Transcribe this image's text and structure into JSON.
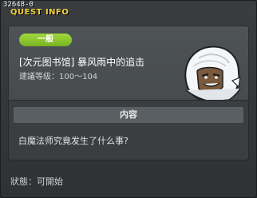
{
  "window": {
    "id": "32648-0",
    "title": "QUEST INFO"
  },
  "quest": {
    "category": "一般",
    "name": "[次元图书馆] 暴风雨中的追击",
    "level_label": "建議等级：",
    "level_range": "100～104",
    "portrait_icon": "white-hooded-character-portrait"
  },
  "content": {
    "header": "内容",
    "text": "白魔法师究竟发生了什么事?"
  },
  "status": {
    "label": "狀態：",
    "value": "可開始"
  },
  "colors": {
    "title_yellow": "#f0d040",
    "badge_green": "#8cc630",
    "panel_bg": "#4a4e51",
    "window_bg": "#2f3133"
  }
}
